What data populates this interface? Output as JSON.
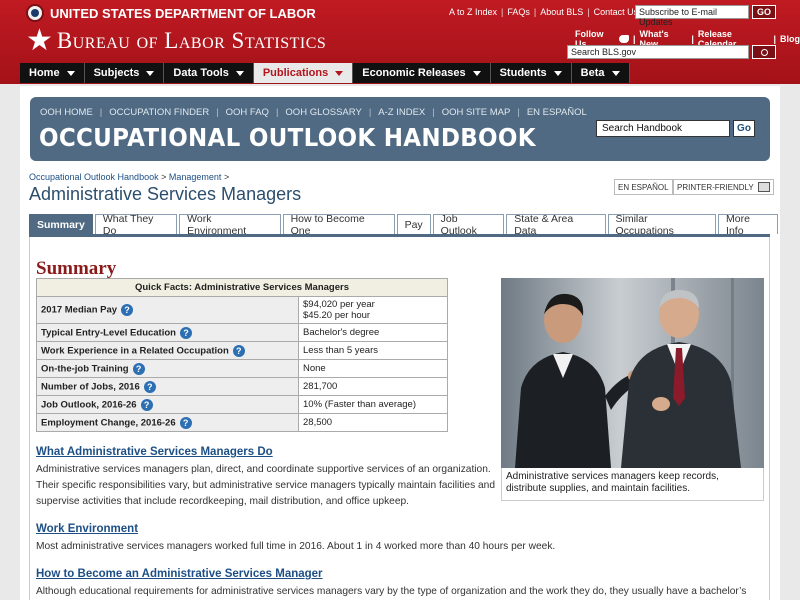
{
  "header": {
    "dol_name": "UNITED STATES DEPARTMENT OF LABOR",
    "bls_name": "Bureau of Labor Statistics",
    "top_links": [
      "A to Z Index",
      "FAQs",
      "About BLS",
      "Contact Us"
    ],
    "subscribe_placeholder": "Subscribe to E-mail Updates",
    "go_label": "GO",
    "follow_label": "Follow Us",
    "links2": [
      "What's New",
      "Release Calendar",
      "Blog"
    ],
    "search_placeholder": "Search BLS.gov"
  },
  "nav": [
    {
      "label": "Home"
    },
    {
      "label": "Subjects"
    },
    {
      "label": "Data Tools"
    },
    {
      "label": "Publications"
    },
    {
      "label": "Economic Releases"
    },
    {
      "label": "Students"
    },
    {
      "label": "Beta"
    }
  ],
  "ooh": {
    "links": [
      "OOH HOME",
      "OCCUPATION FINDER",
      "OOH FAQ",
      "OOH GLOSSARY",
      "A-Z INDEX",
      "OOH SITE MAP",
      "EN ESPAÑOL"
    ],
    "title": "OCCUPATIONAL OUTLOOK HANDBOOK",
    "search_placeholder": "Search Handbook",
    "go_label": "Go"
  },
  "breadcrumb": {
    "items": [
      "Occupational Outlook Handbook",
      "Management"
    ],
    "sep": ">"
  },
  "page": {
    "title": "Administrative Services Managers",
    "espanol": "EN ESPAÑOL",
    "printer": "PRINTER-FRIENDLY"
  },
  "tabs": [
    "Summary",
    "What They Do",
    "Work Environment",
    "How to Become One",
    "Pay",
    "Job Outlook",
    "State & Area Data",
    "Similar Occupations",
    "More Info"
  ],
  "summary": {
    "heading": "Summary",
    "quick_facts_title": "Quick Facts: Administrative Services Managers",
    "rows": [
      {
        "label": "2017 Median Pay",
        "value": "$94,020 per year",
        "value2": "$45.20 per hour",
        "info": true
      },
      {
        "label": "Typical Entry-Level Education",
        "value": "Bachelor's degree",
        "info": true
      },
      {
        "label": "Work Experience in a Related Occupation",
        "value": "Less than 5 years",
        "info": true
      },
      {
        "label": "On-the-job Training",
        "value": "None",
        "info": true
      },
      {
        "label": "Number of Jobs, 2016",
        "value": "281,700",
        "info": true
      },
      {
        "label": "Job Outlook, 2016-26",
        "value": "10% (Faster than average)",
        "info": true
      },
      {
        "label": "Employment Change, 2016-26",
        "value": "28,500",
        "info": true
      }
    ],
    "photo_caption": "Administrative services managers keep records, distribute supplies, and maintain facilities."
  },
  "sections": {
    "what_h": "What Administrative Services Managers Do",
    "what_p": "Administrative services managers plan, direct, and coordinate supportive services of an organization. Their specific responsibilities vary, but administrative service managers typically maintain facilities and supervise activities that include recordkeeping, mail distribution, and office upkeep.",
    "env_h": "Work Environment",
    "env_p": "Most administrative services managers worked full time in 2016. About 1 in 4 worked more than 40 hours per week.",
    "become_h": "How to Become an Administrative Services Manager",
    "become_p": "Although educational requirements for administrative services managers vary by the type of organization and the work they do, they usually have a bachelor’s"
  },
  "colors": {
    "header_red": "#b3151c",
    "banner_blue": "#4f6a82",
    "summary_red": "#8b1a1a",
    "link_blue": "#1d4f86"
  }
}
